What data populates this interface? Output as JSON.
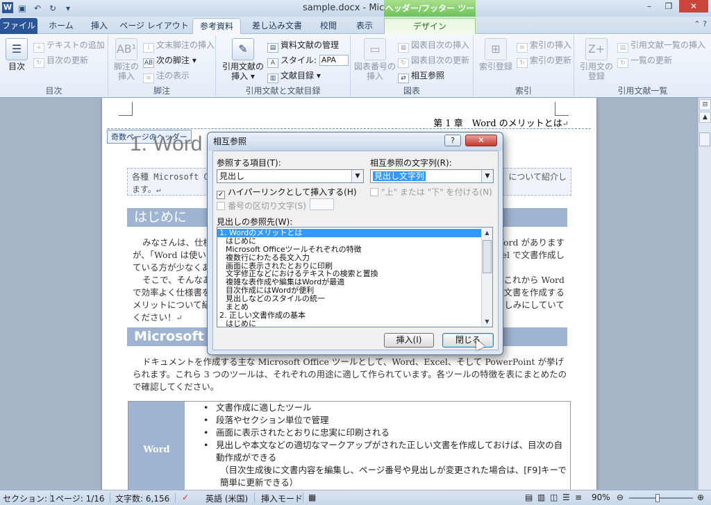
{
  "window": {
    "title": "sample.docx - Microsoft Word",
    "app_icon": "W",
    "context_tab_group": "ヘッダー/フッター ツール"
  },
  "tabs": [
    {
      "label": "ファイル"
    },
    {
      "label": "ホーム"
    },
    {
      "label": "挿入"
    },
    {
      "label": "ページ レイアウト"
    },
    {
      "label": "参考資料"
    },
    {
      "label": "差し込み文書"
    },
    {
      "label": "校閲"
    },
    {
      "label": "表示"
    },
    {
      "label": "デザイン"
    }
  ],
  "ribbon": {
    "toc": {
      "label": "目次",
      "big_button": "目次",
      "add_text": "テキストの追加",
      "update_toc": "目次の更新"
    },
    "footnotes": {
      "label": "脚注",
      "insert_footnote_1": "脚注の",
      "insert_footnote_2": "挿入",
      "insert_endnote": "文末脚注の挿入",
      "next_footnote": "次の脚注",
      "show_notes": "注の表示"
    },
    "citations": {
      "label": "引用文献と文献目録",
      "insert_citation_1": "引用文献の",
      "insert_citation_2": "挿入",
      "manage_sources": "資料文献の管理",
      "style_label": "スタイル:",
      "style_value": "APA",
      "bibliography": "文献目録"
    },
    "captions": {
      "label": "図表",
      "insert_caption_1": "図表番号の",
      "insert_caption_2": "挿入",
      "insert_table_of_figures": "図表目次の挿入",
      "update_table": "図表目次の更新",
      "cross_reference": "相互参照"
    },
    "index": {
      "label": "索引",
      "mark_entry": "索引登録",
      "insert_index": "索引の挿入",
      "update_index": "索引の更新"
    },
    "authorities": {
      "label": "引用文献一覧",
      "mark_citation_1": "引用文の",
      "mark_citation_2": "登録",
      "insert_table": "引用文献一覧の挿入",
      "update_table": "一覧の更新"
    }
  },
  "document": {
    "header_text": "第 1 章　Word のメリットとは",
    "header_tag": "奇数ページのヘッダー",
    "heading1": "1. Word",
    "abstract_left": "各種 Microsoft Off",
    "abstract_right": "について紹介し",
    "abstract_line2": "ます。",
    "h2_intro": "はじめに",
    "p1_a": "みなさんは、仕様",
    "p1_b": "が、「Word は使い",
    "p1_c": "ている方が少なくあ",
    "p1_right_a": "Word があります",
    "p1_right_b": "cel で文書作成し",
    "p2_a": "そこで、そんなあ",
    "p2_b": "で効率よく仕様書を",
    "p2_c": "メリットについて紹",
    "p2_d": "ください！",
    "p2_right_a": "これから Word",
    "p2_right_b": "文書を作成する",
    "p2_right_c": "しみにしていて",
    "h2_ms": "Microsoft O",
    "p3": "ドキュメントを作成する主な Microsoft Office ツールとして、Word、Excel、そして PowerPoint が挙げられます。これら 3 つのツールは、それぞれの用途に適して作られています。各ツールの特徴を表にまとめたので確認してください。",
    "table_label": "Word",
    "table_items": [
      "文書作成に適したツール",
      "段落やセクション単位で管理",
      "画面に表示されたとおりに忠実に印刷される",
      "見出しや本文などの適切なマークアップがされた正しい文書を作成しておけば、目次の自動作成ができる",
      "（目次生成後に文書内容を編集し、ページ番号や見出しが変更された場合は、[F9]キーで簡単に更新できる）"
    ]
  },
  "dialog": {
    "title": "相互参照",
    "help": "?",
    "close_x": "✕",
    "ref_type_label": "参照する項目(T):",
    "ref_type_value": "見出し",
    "insert_ref_label": "相互参照の文字列(R):",
    "insert_ref_value": "見出し文字列",
    "hyperlink_label": "ハイパーリンクとして挿入する(H)",
    "hyperlink_checked": true,
    "above_below_label": "\"上\" または \"下\" を付ける(N)",
    "separator_label": "番号の区切り文字(S)",
    "for_which_label": "見出しの参照先(W):",
    "headings": [
      {
        "text": "1. Wordのメリットとは",
        "level": 1,
        "selected": true
      },
      {
        "text": "はじめに",
        "level": 2
      },
      {
        "text": "Microsoft Officeツールそれぞれの特徴",
        "level": 2
      },
      {
        "text": "複数行にわたる長文入力",
        "level": 2
      },
      {
        "text": "画面に表示されたとおりに印刷",
        "level": 2
      },
      {
        "text": "文字修正などにおけるテキストの検索と置換",
        "level": 2
      },
      {
        "text": "複雑な表作成や編集はWordが最適",
        "level": 2
      },
      {
        "text": "目次作成にはWordが便利",
        "level": 2
      },
      {
        "text": "見出しなどのスタイルの統一",
        "level": 2
      },
      {
        "text": "まとめ",
        "level": 2
      },
      {
        "text": "2. 正しい文書作成の基本",
        "level": 1
      },
      {
        "text": "はじめに",
        "level": 2
      }
    ],
    "insert_button": "挿入(I)",
    "close_button": "閉じる"
  },
  "statusbar": {
    "section": "セクション: 1",
    "page": "ページ: 1/16",
    "words": "文字数: 6,156",
    "language": "英語 (米国)",
    "mode": "挿入モード",
    "zoom": "90%"
  }
}
